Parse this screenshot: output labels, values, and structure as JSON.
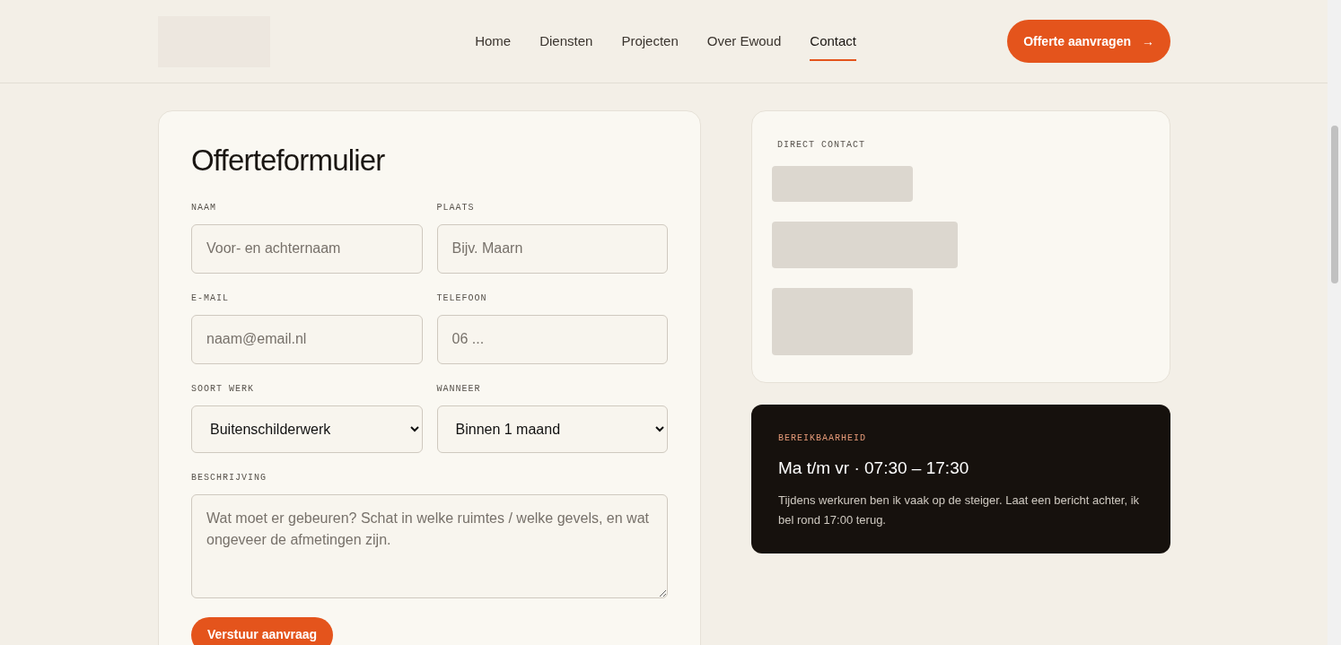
{
  "header": {
    "nav": [
      {
        "label": "Home",
        "selected": false
      },
      {
        "label": "Diensten",
        "selected": false
      },
      {
        "label": "Projecten",
        "selected": false
      },
      {
        "label": "Over Ewoud",
        "selected": false
      },
      {
        "label": "Contact",
        "selected": true
      }
    ],
    "cta": {
      "label": "Offerte aanvragen",
      "arrow": "→"
    }
  },
  "form": {
    "title": "Offerteformulier",
    "fields": [
      {
        "kind": "input",
        "label": "NAAM",
        "placeholder": "Voor- en achternaam"
      },
      {
        "kind": "input",
        "label": "PLAATS",
        "placeholder": "Bijv. Maarn"
      },
      {
        "kind": "input",
        "label": "E-MAIL",
        "placeholder": "naam@email.nl"
      },
      {
        "kind": "input",
        "label": "TELEFOON",
        "placeholder": "06 ..."
      },
      {
        "kind": "select",
        "label": "SOORT WERK",
        "value": "Buitenschilderwerk"
      },
      {
        "kind": "select",
        "label": "WANNEER",
        "value": "Binnen 1 maand"
      },
      {
        "kind": "textarea",
        "label": "BESCHRIJVING",
        "placeholder": "Wat moet er gebeuren? Schat in welke ruimtes / welke gevels, en wat ongeveer de afmetingen zijn."
      }
    ],
    "submit": "Verstuur aanvraag"
  },
  "direct_contact": {
    "heading": "DIRECT CONTACT"
  },
  "availability": {
    "heading": "BEREIKBAARHEID",
    "hours": "Ma t/m vr · 07:30 – 17:30",
    "text": "Tijdens werkuren ben ik vaak op de steiger. Laat een bericht achter, ik bel rond 17:00 terug."
  }
}
